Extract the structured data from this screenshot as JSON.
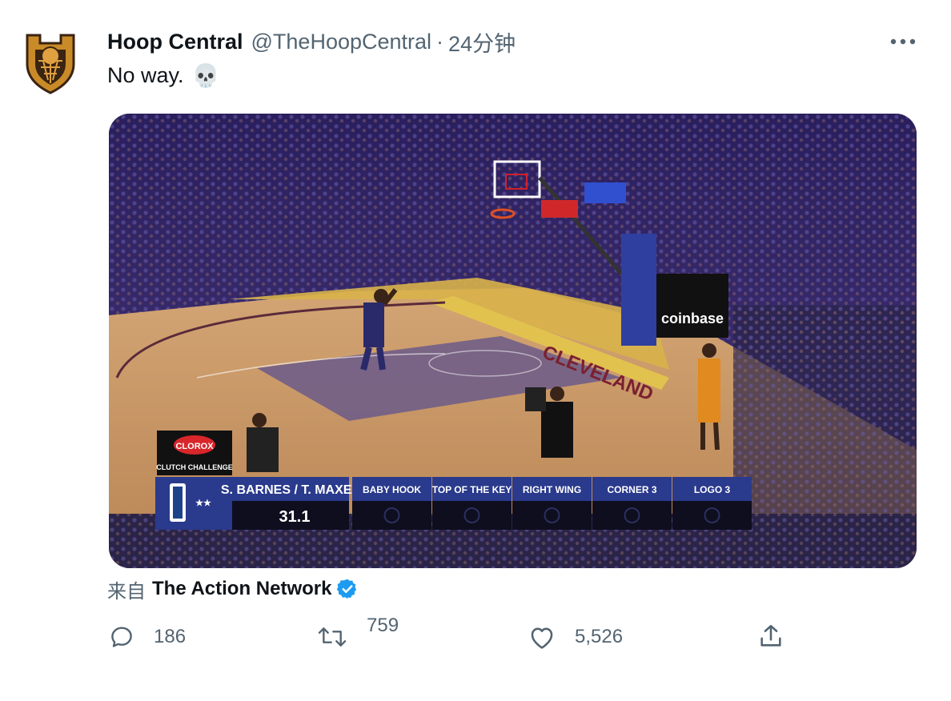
{
  "tweet": {
    "author_name": "Hoop Central",
    "handle": "@TheHoopCentral",
    "separator": "·",
    "time": "24分钟",
    "text": "No way.",
    "emoji": "💀"
  },
  "icons": {
    "avatar": "hoop-central-logo",
    "more": "more-dots-icon",
    "verified": "verified-badge-icon",
    "reply": "reply-icon",
    "retweet": "retweet-icon",
    "like": "like-icon",
    "share": "share-icon"
  },
  "media": {
    "scorebug": {
      "sponsor": "CLOROX",
      "event": "CLUTCH CHALLENGE",
      "players": "S. BARNES / T. MAXEY",
      "timer": "31.1",
      "spots": [
        "BABY HOOK",
        "TOP OF THE KEY",
        "RIGHT WING",
        "CORNER 3",
        "LOGO 3"
      ]
    },
    "court_text": "CLEVELAND",
    "signage": "coinbase"
  },
  "source": {
    "prefix": "来自",
    "name": "The Action Network"
  },
  "actions": {
    "replies": "186",
    "retweets": "759",
    "likes": "5,526"
  },
  "colors": {
    "verified_blue": "#1d9bf0",
    "secondary_text": "#536471",
    "scorebug_blue": "#2a3a8c",
    "court_wood": "#c79462"
  }
}
